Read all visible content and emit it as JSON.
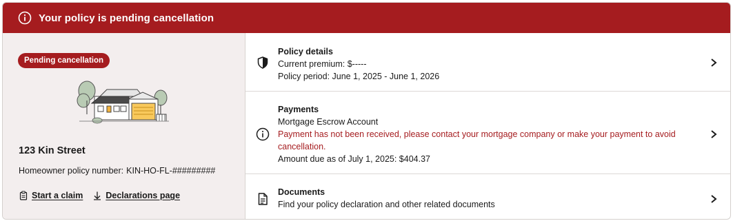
{
  "banner": {
    "icon": "info-circle-icon",
    "text": "Your policy is pending cancellation",
    "bg_color": "#a51c1f"
  },
  "summary": {
    "badge": "Pending cancellation",
    "house_icon": "house-illustration",
    "address": "123 Kin Street",
    "policy_number_label": "Homeowner policy number:",
    "policy_number": "KIN-HO-FL-#########",
    "actions": [
      {
        "icon": "clipboard-icon",
        "label": "Start a claim"
      },
      {
        "icon": "download-arrow-icon",
        "label": "Declarations page"
      }
    ]
  },
  "sections": {
    "policy_details": {
      "icon": "shield-icon",
      "title": "Policy details",
      "lines": [
        "Current premium: $-----",
        "Policy period: June 1, 2025 - June 1, 2026"
      ]
    },
    "payments": {
      "icon": "info-circle-icon",
      "title": "Payments",
      "account": "Mortgage Escrow Account",
      "warning": "Payment has not been received, please contact your mortgage company or make your payment to avoid cancellation.",
      "amount_due": "Amount due as of July 1, 2025: $404.37"
    },
    "documents": {
      "icon": "document-icon",
      "title": "Documents",
      "description": "Find your policy declaration and other related documents"
    }
  },
  "colors": {
    "accent": "#a51c1f",
    "panel_bg": "#f3eeee"
  }
}
